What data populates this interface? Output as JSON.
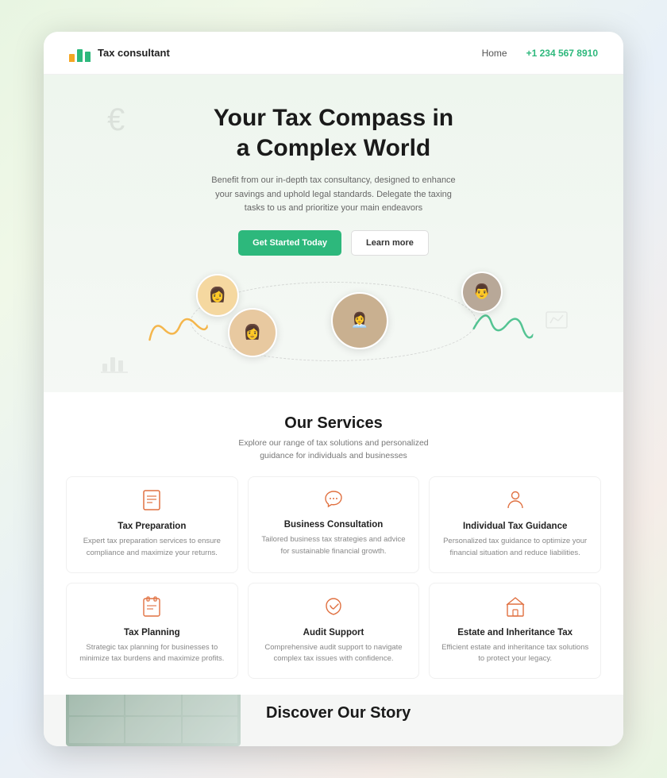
{
  "navbar": {
    "logo_text": "Tax consultant",
    "nav_home": "Home",
    "nav_phone": "+1 234 567 8910"
  },
  "hero": {
    "headline_line1": "Your Tax Compass in",
    "headline_line2": "a Complex World",
    "subtitle": "Benefit from our in-depth tax consultancy, designed to enhance your savings and uphold legal standards. Delegate the taxing tasks to us and prioritize your main endeavors",
    "btn_primary": "Get Started Today",
    "btn_secondary": "Learn more"
  },
  "services": {
    "title": "Our Services",
    "subtitle": "Explore our range of tax solutions and personalized guidance for individuals and businesses",
    "cards": [
      {
        "name": "Tax Preparation",
        "desc": "Expert tax preparation services to ensure compliance and maximize your returns.",
        "icon": "📄"
      },
      {
        "name": "Business Consultation",
        "desc": "Tailored business tax strategies and advice for sustainable financial growth.",
        "icon": "💬"
      },
      {
        "name": "Individual Tax Guidance",
        "desc": "Personalized tax guidance to optimize your financial situation and reduce liabilities.",
        "icon": "👤"
      },
      {
        "name": "Tax Planning",
        "desc": "Strategic tax planning for businesses to minimize tax burdens and maximize profits.",
        "icon": "📋"
      },
      {
        "name": "Audit Support",
        "desc": "Comprehensive audit support to navigate complex tax issues with confidence.",
        "icon": "🎧"
      },
      {
        "name": "Estate and Inheritance Tax",
        "desc": "Efficient estate and inheritance tax solutions to protect your legacy.",
        "icon": "🏠"
      }
    ]
  },
  "bottom": {
    "discover_title": "Discover Our Story"
  }
}
